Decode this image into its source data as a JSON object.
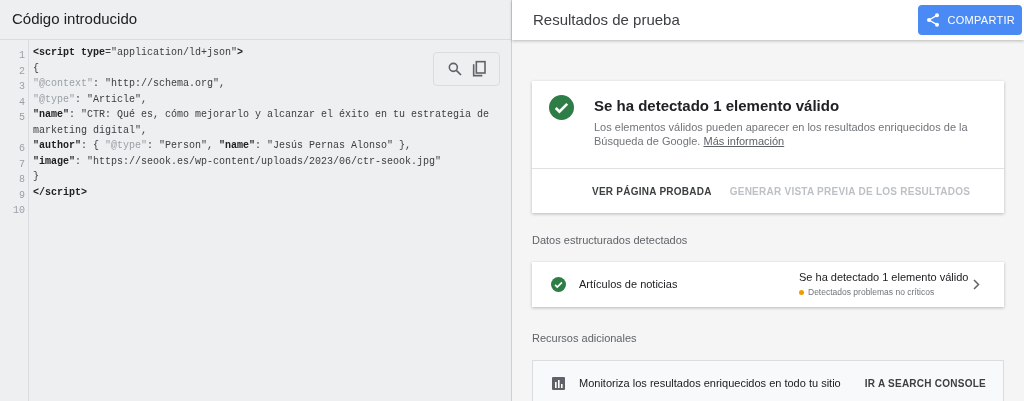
{
  "code_panel": {
    "title": "Código introducido",
    "lines": [
      {
        "number": "1",
        "tokens": [
          {
            "text": "<script ",
            "kind": "strong"
          },
          {
            "text": "type",
            "kind": "strong"
          },
          {
            "text": "=",
            "kind": "plain"
          },
          {
            "text": "\"application/ld+json\"",
            "kind": "plain"
          },
          {
            "text": ">",
            "kind": "strong"
          }
        ]
      },
      {
        "number": "2",
        "tokens": [
          {
            "text": "{",
            "kind": "plain"
          }
        ]
      },
      {
        "number": "3",
        "tokens": [
          {
            "text": "\"@context\"",
            "kind": "muted"
          },
          {
            "text": ": \"http://schema.org\",",
            "kind": "plain"
          }
        ]
      },
      {
        "number": "4",
        "tokens": [
          {
            "text": "\"@type\"",
            "kind": "muted"
          },
          {
            "text": ": \"Article\",",
            "kind": "plain"
          }
        ]
      },
      {
        "number": "5",
        "tokens": [
          {
            "text": "\"name\"",
            "kind": "strong"
          },
          {
            "text": ": \"CTR: Qué es, cómo mejorarlo y alcanzar el éxito en tu estrategia de marketing digital\",",
            "kind": "plain"
          }
        ]
      },
      {
        "number": "6",
        "tokens": [
          {
            "text": "\"author\"",
            "kind": "strong"
          },
          {
            "text": ": { ",
            "kind": "plain"
          },
          {
            "text": "\"@type\"",
            "kind": "muted"
          },
          {
            "text": ": \"Person\", ",
            "kind": "plain"
          },
          {
            "text": "\"name\"",
            "kind": "strong"
          },
          {
            "text": ": \"Jesús Pernas Alonso\" },",
            "kind": "plain"
          }
        ]
      },
      {
        "number": "7",
        "tokens": [
          {
            "text": "\"image\"",
            "kind": "strong"
          },
          {
            "text": ": \"https://seook.es/wp-content/uploads/2023/06/ctr-seook.jpg\"",
            "kind": "plain"
          }
        ]
      },
      {
        "number": "8",
        "tokens": [
          {
            "text": "}",
            "kind": "plain"
          }
        ]
      },
      {
        "number": "9",
        "tokens": [
          {
            "text": "</script>",
            "kind": "strong"
          }
        ]
      },
      {
        "number": "10"
      }
    ]
  },
  "results_panel": {
    "title": "Resultados de prueba",
    "share_button": "COMPARTIR",
    "summary": {
      "heading": "Se ha detectado 1 elemento válido",
      "description": "Los elementos válidos pueden aparecer en los resultados enriquecidos de la Búsqueda de Google.",
      "link": "Más información",
      "actions": [
        {
          "label": "VER PÁGINA PROBADA",
          "disabled": false
        },
        {
          "label": "GENERAR VISTA PREVIA DE LOS RESULTADOS",
          "disabled": true
        }
      ]
    },
    "structured_data": {
      "heading": "Datos estructurados detectados",
      "items": [
        {
          "name": "Artículos de noticias",
          "status": "Se ha detectado 1 elemento válido",
          "note": "Detectados problemas no críticos",
          "color": "#f29900"
        }
      ]
    },
    "resources": {
      "heading": "Recursos adicionales",
      "text": "Monitoriza los resultados enriquecidos en todo tu sitio",
      "action": "IR A SEARCH CONSOLE"
    }
  }
}
